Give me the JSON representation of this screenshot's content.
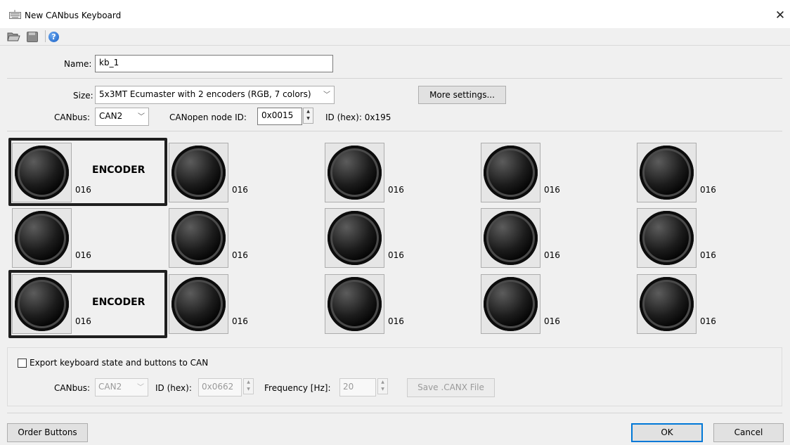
{
  "window": {
    "title": "New CANbus Keyboard",
    "close_glyph": "✕"
  },
  "toolbar": {
    "open_icon": "folder-open-icon",
    "save_icon": "save-icon",
    "help_icon": "help-icon",
    "help_glyph": "?"
  },
  "form": {
    "name_label": "Name:",
    "name_value": "kb_1",
    "size_label": "Size:",
    "size_value": "5x3MT Ecumaster with 2 encoders (RGB, 7 colors)",
    "more_settings": "More settings...",
    "canbus_label": "CANbus:",
    "canbus_value": "CAN2",
    "node_label": "CANopen node ID:",
    "node_value": "0x0015",
    "id_hex_text": "ID (hex): 0x195"
  },
  "keys": {
    "encoder_label": "ENCODER",
    "rows": [
      [
        "016",
        "016",
        "016",
        "016",
        "016"
      ],
      [
        "016",
        "016",
        "016",
        "016",
        "016"
      ],
      [
        "016",
        "016",
        "016",
        "016",
        "016"
      ]
    ]
  },
  "export": {
    "checkbox_label": "Export keyboard state and buttons to CAN",
    "checked": false,
    "canbus_label": "CANbus:",
    "canbus_value": "CAN2",
    "id_label": "ID (hex):",
    "id_value": "0x0662",
    "freq_label": "Frequency [Hz]:",
    "freq_value": "20",
    "save_button": "Save .CANX File"
  },
  "footer": {
    "order_buttons": "Order Buttons",
    "ok": "OK",
    "cancel": "Cancel"
  }
}
